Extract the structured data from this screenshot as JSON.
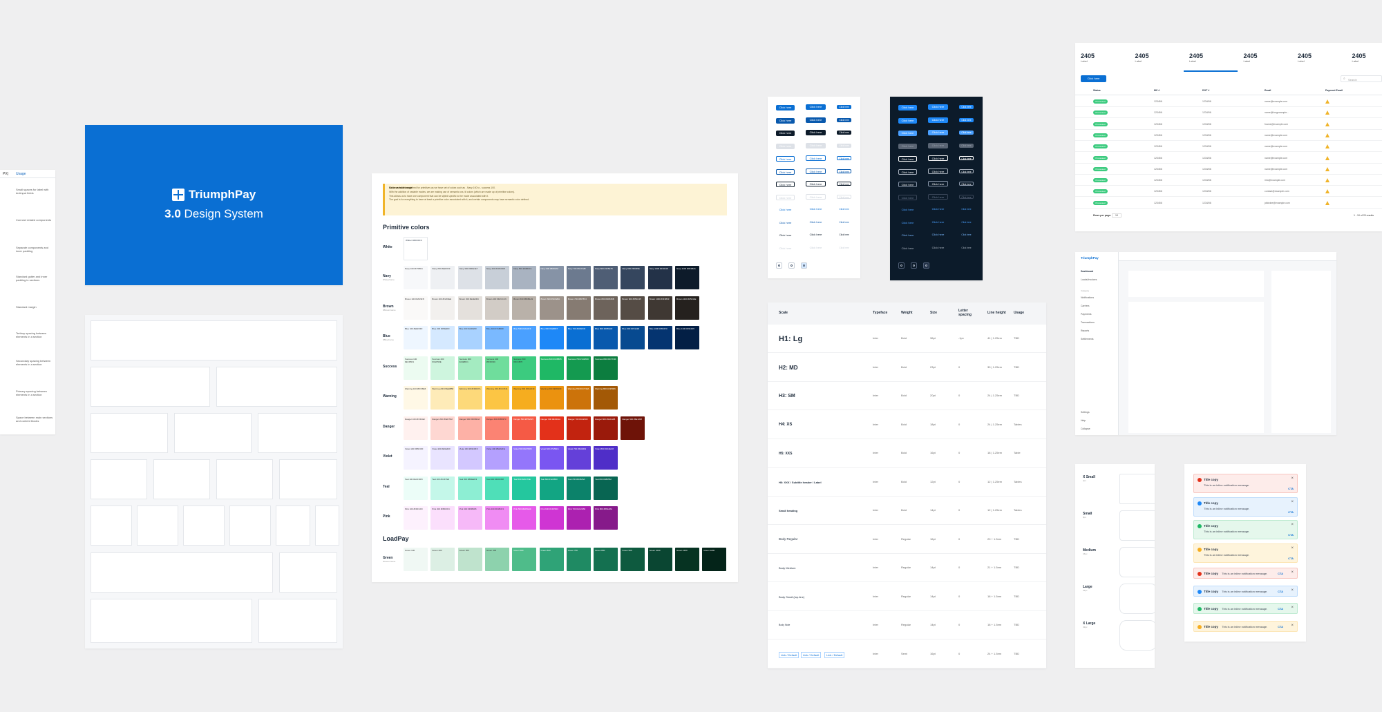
{
  "spacing": {
    "headers": [
      "PX)",
      "Usage"
    ],
    "rows": [
      "Small spaces for label with textinput fields",
      "Connect related components",
      "Separate components and inner padding",
      "Standard gutter and inner padding in sections",
      "Standard margin",
      "Tertiary spacing between elements in a section",
      "Secondary spacing between elements in a section",
      "Primary spacing between elements in a section",
      "Space between main sections and content blocks"
    ]
  },
  "hero": {
    "brand": "TriumphPay",
    "version": "3.0",
    "subtitle": "Design System",
    "color": "#0a6fd3"
  },
  "colors": {
    "note_title": "Color variable usage",
    "note_lines": [
      "We have variables defined for primitives as we have set of colors such as - Navy 100 to - success 100.",
      "With the addition of variable modes, we are making use of semantic css, til colors (which are made up of primitive colors).",
      "This allows us to have one component that can be styled specific to the mode associated with it.",
      "The goal is for everything to have at least a primitive color associated with it, and certain components may have semantic color defined."
    ],
    "primitive_title": "Primitive colors",
    "loadpay_title": "LoadPay",
    "white_label": "White",
    "white_swatch": "White 0\n#FFFFFF",
    "palettes": [
      {
        "name": "Navy",
        "sub": "#Navy/name",
        "colors": [
          "#f7f8fa",
          "#eef0f3",
          "#dde1e7",
          "#c8cfd8",
          "#a9b3c1",
          "#8693a6",
          "#6c7a8f",
          "#4f5e75",
          "#35465e",
          "#233248",
          "#0d1b2a"
        ]
      },
      {
        "name": "Brown",
        "sub": "#Brown/name",
        "colors": [
          "#faf9f8",
          "#f2f0ee",
          "#e4e0dc",
          "#d2ccc6",
          "#b9b1a9",
          "#9c928a",
          "#867b72",
          "#6d635b",
          "#554c45",
          "#3f3833",
          "#25211e"
        ]
      },
      {
        "name": "Blue",
        "sub": "#Blue/name",
        "colors": [
          "#eef6ff",
          "#d5e9ff",
          "#a9d2ff",
          "#7ab9ff",
          "#4aa0ff",
          "#1e88f7",
          "#0a6fd3",
          "#0959ad",
          "#074a90",
          "#053470",
          "#031f45"
        ]
      },
      {
        "name": "Success",
        "sub": "",
        "colors": [
          "#ecfbf1",
          "#cef5de",
          "#a4ebc1",
          "#6fdd9c",
          "#3ccb7f",
          "#1fb865",
          "#149a50",
          "#0c7d3f"
        ]
      },
      {
        "name": "Warning",
        "sub": "",
        "colors": [
          "#fff8e6",
          "#feebb8",
          "#fdd97a",
          "#fcc544",
          "#f6ad1f",
          "#eb920f",
          "#cc730a",
          "#a35906"
        ]
      },
      {
        "name": "Danger",
        "sub": "",
        "colors": [
          "#fff1ef",
          "#fed7d2",
          "#fdb1a6",
          "#fb8373",
          "#f55a45",
          "#e3311a",
          "#c2230f",
          "#9a1a0b",
          "#6e1308"
        ]
      },
      {
        "name": "Violet",
        "sub": "",
        "colors": [
          "#f5f3ff",
          "#e9e4ff",
          "#d3c8ff",
          "#b4a0fe",
          "#9476fb",
          "#7a56f1",
          "#6440d9",
          "#4f2ec8"
        ]
      },
      {
        "name": "Teal",
        "sub": "",
        "colors": [
          "#ecfdf8",
          "#c4f7e9",
          "#8deed3",
          "#4fdfb8",
          "#24c79e",
          "#12a583",
          "#0c826a",
          "#086552"
        ]
      },
      {
        "name": "Pink",
        "sub": "",
        "colors": [
          "#fdf1fd",
          "#fbdffc",
          "#f6b9f8",
          "#f08cf3",
          "#e65ae9",
          "#cf35d3",
          "#ac21b0",
          "#861a8a"
        ]
      }
    ],
    "loadpay": {
      "name": "Green",
      "sub": "#Green/name",
      "colors": [
        "#f0f8f4",
        "#dcefe4",
        "#bfe3cd",
        "#8dd2ad",
        "#4fbc8a",
        "#2fa377",
        "#1f8a63",
        "#147050",
        "#0e5a3f",
        "#0a4632",
        "#063322",
        "#042419"
      ]
    }
  },
  "buttons": {
    "label": "Click here"
  },
  "typography": {
    "headers": [
      "Scale",
      "Typeface",
      "Weight",
      "Size",
      "Letter spacing",
      "Line height",
      "Usage"
    ],
    "rows": [
      {
        "scale": "H1: Lg",
        "typeface": "Inter",
        "weight": "Bold",
        "size": "36pt",
        "ls": "-1px",
        "lh": "41 | 1.25em",
        "usage": "TBD"
      },
      {
        "scale": "H2: MD",
        "typeface": "Inter",
        "weight": "Bold",
        "size": "23pt",
        "ls": "0",
        "lh": "30 | 1.25em",
        "usage": "TBD"
      },
      {
        "scale": "H3: SM",
        "typeface": "Inter",
        "weight": "Bold",
        "size": "20pt",
        "ls": "0",
        "lh": "24 | 1.25em",
        "usage": "TBD"
      },
      {
        "scale": "H4: XS",
        "typeface": "Inter",
        "weight": "Bold",
        "size": "18pt",
        "ls": "0",
        "lh": "24 | 1.25em",
        "usage": "Tables"
      },
      {
        "scale": "H5: XXS",
        "typeface": "Inter",
        "weight": "Bold",
        "size": "16pt",
        "ls": "0",
        "lh": "18 | 1.25em",
        "usage": "Table"
      },
      {
        "scale": "H6: XXX / Subtitle header / Label",
        "typeface": "Inter",
        "weight": "Bold",
        "size": "12pt",
        "ls": "0",
        "lh": "12 | 1.25em",
        "usage": "Tables"
      },
      {
        "scale": "Small heading",
        "typeface": "Inter",
        "weight": "Bold",
        "size": "14pt",
        "ls": "0",
        "lh": "12 | 1.25em",
        "usage": "Tables"
      },
      {
        "scale": "Body Regular",
        "typeface": "Inter",
        "weight": "Regular",
        "size": "16pt",
        "ls": "0",
        "lh": "20 + 1.5em",
        "usage": "TBD"
      },
      {
        "scale": "Body Medium",
        "typeface": "Inter",
        "weight": "Regular",
        "size": "14pt",
        "ls": "0",
        "lh": "21 + 1.5em",
        "usage": "TBD"
      },
      {
        "scale": "Body Small (top-line)",
        "typeface": "Inter",
        "weight": "Regular",
        "size": "14pt",
        "ls": "0",
        "lh": "18 + 1.5em",
        "usage": "TBD"
      },
      {
        "scale": "Body Note",
        "typeface": "Inter",
        "weight": "Regular",
        "size": "14pt",
        "ls": "0",
        "lh": "18 + 1.5em",
        "usage": "TBD"
      },
      {
        "scale": "",
        "typeface": "Inter",
        "weight": "Semi",
        "size": "16pt",
        "ls": "0",
        "lh": "24 + 1.5em",
        "usage": "TBD"
      }
    ],
    "links": [
      "Link / Default",
      "Link / Default",
      "Link / Default"
    ]
  },
  "table": {
    "kpis": [
      {
        "value": "2405",
        "label": "Label"
      },
      {
        "value": "2405",
        "label": "Label"
      },
      {
        "value": "2405",
        "label": "Label"
      },
      {
        "value": "2405",
        "label": "Label"
      },
      {
        "value": "2405",
        "label": "Label"
      },
      {
        "value": "2405",
        "label": "Label"
      }
    ],
    "button": "Click here",
    "search_placeholder": "Search",
    "headers": [
      "Status",
      "MC #",
      "DOT #",
      "Email",
      "Payment Email"
    ],
    "status_label": "Processed",
    "rows": [
      {
        "mc": "123456",
        "dot": "1234/56",
        "email": "name@example.com"
      },
      {
        "mc": "123456",
        "dot": "1234/56",
        "email": "name@longexample..."
      },
      {
        "mc": "123456",
        "dot": "1234/56",
        "email": "fname@example.com"
      },
      {
        "mc": "123456",
        "dot": "1234/56",
        "email": "name@example.com"
      },
      {
        "mc": "123456",
        "dot": "1234/56",
        "email": "name@example.com"
      },
      {
        "mc": "123456",
        "dot": "1234/56",
        "email": "name@example.com"
      },
      {
        "mc": "123456",
        "dot": "1234/56",
        "email": "name@example.com"
      },
      {
        "mc": "123456",
        "dot": "1234/56",
        "email": "info@example.com"
      },
      {
        "mc": "123456",
        "dot": "1234/56",
        "email": "contact@example.com"
      },
      {
        "mc": "123456",
        "dot": "1234/56",
        "email": "jdstrobe@example.com"
      }
    ],
    "rows_per_page_label": "Rows per page:",
    "rows_per_page_value": "10",
    "range": "1 - 10 of 20 results"
  },
  "dashboard": {
    "brand": "TriumphPay",
    "nav": [
      "Dashboard",
      "Loads/Invoices"
    ],
    "category": "Category",
    "items": [
      "Notifications",
      "Carriers",
      "Payments",
      "Transactions",
      "Reports",
      "Settlements"
    ],
    "footer": [
      "Settings",
      "Help",
      "Collapse"
    ]
  },
  "radius": {
    "sizes": [
      {
        "name": "X Small",
        "value": "4px"
      },
      {
        "name": "Small",
        "value": "8px"
      },
      {
        "name": "Medium",
        "value": "16px"
      },
      {
        "name": "Large",
        "value": "24px"
      },
      {
        "name": "X Large",
        "value": "32px"
      }
    ]
  },
  "notifications": {
    "title": "Title copy",
    "body": "This is an inline notification message.",
    "cta": "CTA",
    "close": "×",
    "types": [
      {
        "bg": "#fdecea",
        "ic": "#e3311a"
      },
      {
        "bg": "#e7f2fd",
        "ic": "#1e88f7"
      },
      {
        "bg": "#e5f7ec",
        "ic": "#1fb865"
      },
      {
        "bg": "#fef4dc",
        "ic": "#f6ad1f"
      }
    ]
  }
}
